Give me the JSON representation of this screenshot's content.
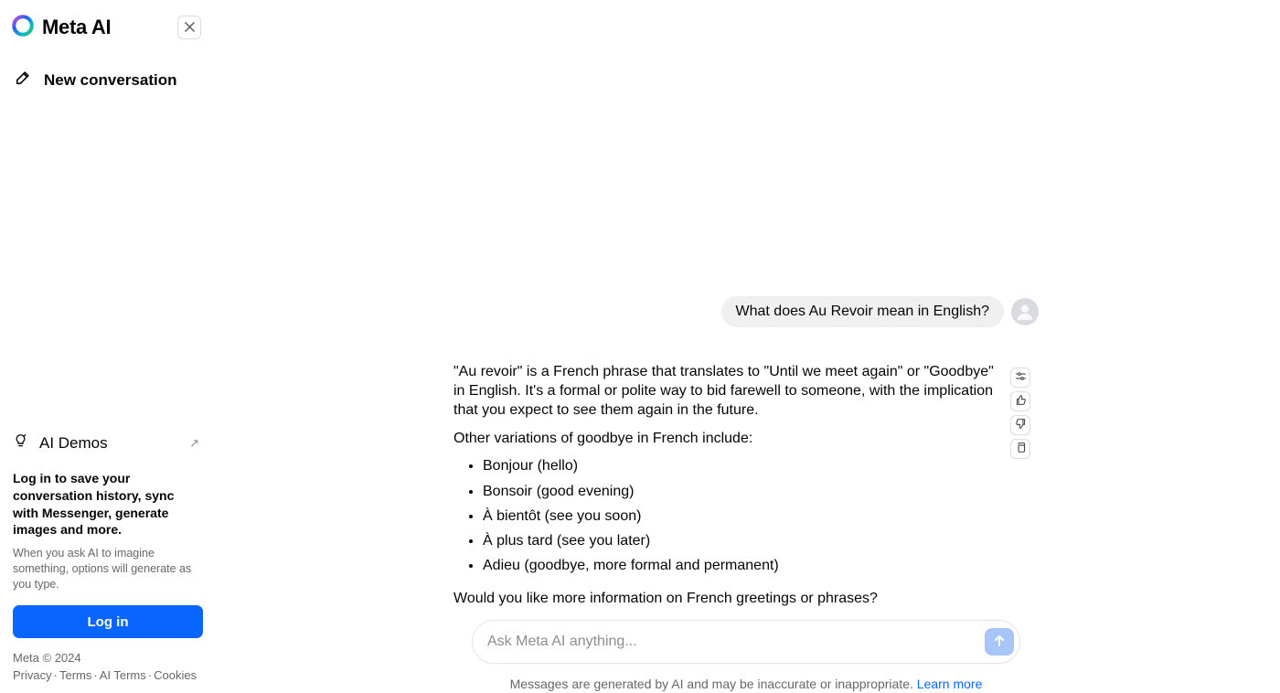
{
  "brand": {
    "name": "Meta AI"
  },
  "sidebar": {
    "new_conversation": "New conversation",
    "ai_demos": "AI Demos",
    "login_prompt_title": "Log in to save your conversation history, sync with Messenger, generate images and more.",
    "login_prompt_desc": "When you ask AI to imagine something, options will generate as you type.",
    "login_button": "Log in",
    "copyright": "Meta © 2024",
    "footer_links": [
      "Privacy",
      "Terms",
      "AI Terms",
      "Cookies"
    ]
  },
  "conversation": {
    "user_message": "What does Au Revoir mean in English?",
    "ai": {
      "p1": "\"Au revoir\" is a French phrase that translates to \"Until we meet again\" or \"Goodbye\" in English. It's a formal or polite way to bid farewell to someone, with the implication that you expect to see them again in the future.",
      "p2": "Other variations of goodbye in French include:",
      "list": [
        "Bonjour (hello)",
        "Bonsoir (good evening)",
        "À bientôt (see you soon)",
        "À plus tard (see you later)",
        "Adieu (goodbye, more formal and permanent)"
      ],
      "p3": "Would you like more information on French greetings or phrases?"
    }
  },
  "composer": {
    "placeholder": "Ask Meta AI anything..."
  },
  "disclaimer": {
    "text": "Messages are generated by AI and may be inaccurate or inappropriate. ",
    "learn_more": "Learn more"
  }
}
